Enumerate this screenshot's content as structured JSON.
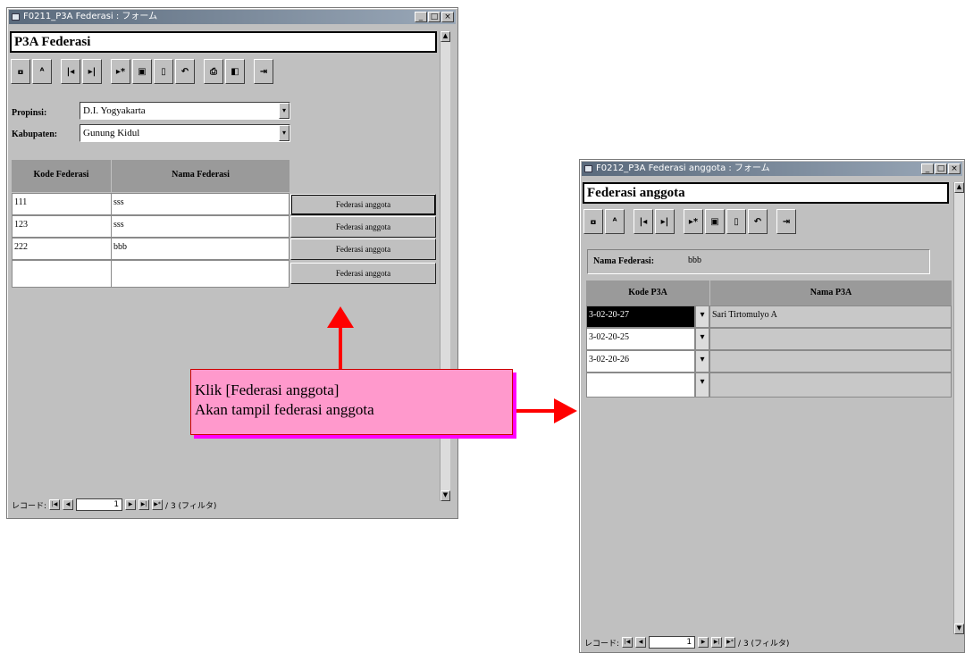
{
  "window1": {
    "title": "F0211_P3A Federasi : フォーム",
    "heading": "P3A Federasi",
    "toolbar": [
      "search-icon",
      "new-record-icon",
      "first-record-icon",
      "last-record-icon",
      "new-entry-icon",
      "save-icon",
      "delete-icon",
      "undo-icon",
      "print-icon",
      "preview-icon",
      "exit-icon"
    ],
    "propinsi_label": "Propinsi:",
    "propinsi_value": "D.I. Yogyakarta",
    "kabupaten_label": "Kabupaten:",
    "kabupaten_value": "Gunung Kidul",
    "columns": [
      "Kode Federasi",
      "Nama Federasi"
    ],
    "rows": [
      {
        "kode": "111",
        "nama": "sss",
        "button": "Federasi anggota"
      },
      {
        "kode": "123",
        "nama": "sss",
        "button": "Federasi anggota"
      },
      {
        "kode": "222",
        "nama": "bbb",
        "button": "Federasi anggota"
      },
      {
        "kode": "",
        "nama": "",
        "button": "Federasi anggota"
      }
    ],
    "nav_label": "レコード:",
    "record_number": "1",
    "record_total": "/ 3 (フィルタ)"
  },
  "window2": {
    "title": "F0212_P3A Federasi anggota : フォーム",
    "heading": "Federasi anggota",
    "toolbar": [
      "search-icon",
      "new-record-icon",
      "first-record-icon",
      "last-record-icon",
      "new-entry-icon",
      "save-icon",
      "delete-icon",
      "undo-icon",
      "exit-icon"
    ],
    "nama_label": "Nama Federasi:",
    "nama_value": "bbb",
    "columns": [
      "Kode P3A",
      "Nama P3A"
    ],
    "rows": [
      {
        "kode": "3-02-20-27",
        "nama": "Sari Tirtomulyo A"
      },
      {
        "kode": "3-02-20-25",
        "nama": ""
      },
      {
        "kode": "3-02-20-26",
        "nama": ""
      },
      {
        "kode": "",
        "nama": ""
      }
    ],
    "nav_label": "レコード:",
    "record_number": "1",
    "record_total": "/ 3 (フィルタ)"
  },
  "callout": {
    "line1": "Klik [Federasi anggota]",
    "line2": "Akan tampil federasi anggota"
  },
  "colors": {
    "arrow": "#ff0000",
    "callout_fill": "#ff99cc",
    "callout_shadow": "#ff00ff",
    "titlebar": "#5a6a7c"
  }
}
